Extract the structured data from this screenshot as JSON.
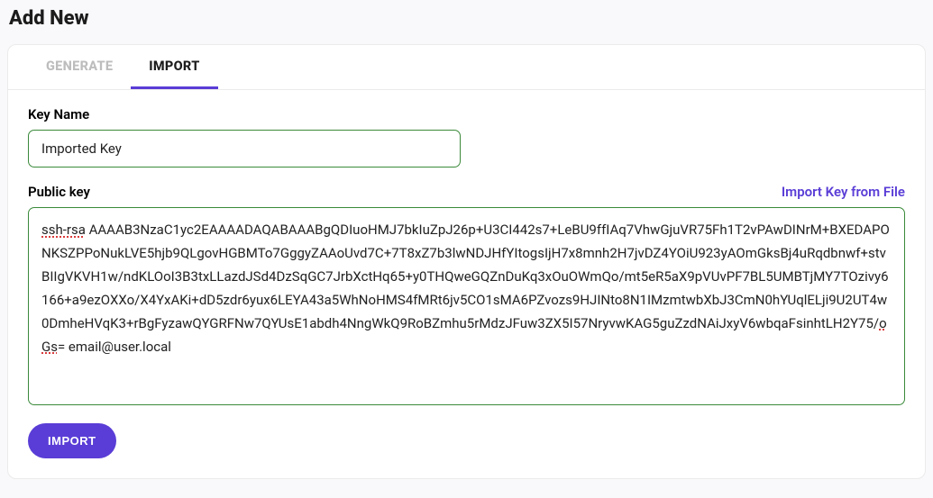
{
  "page_title": "Add New",
  "tabs": {
    "generate_label": "GENERATE",
    "import_label": "IMPORT"
  },
  "key_name": {
    "label": "Key Name",
    "value": "Imported Key"
  },
  "public_key": {
    "label": "Public key",
    "import_file_link": "Import Key from File",
    "value_prefix": "ssh-rsa",
    "value_body": " AAAAB3NzaC1yc2EAAAADAQABAAABgQDIuoHMJ7bkIuZpJ26p+U3CI442s7+LeBU9ffIAq7VhwGjuVR75Fh1T2vPAwDINrM+BXEDAPONKSZPPoNukLVE5hjb9QLgovHGBMTo7GggyZAAoUvd7C+7T8xZ7b3lwNDJHfYItogsIjH7x8mnh2H7jvDZ4YOiU923yAOmGksBj4uRqdbnwf+stvBIIgVKVH1w/ndKLOoI3B3txLLazdJSd4DzSqGC7JrbXctHq65+y0THQweGQZnDuKq3xOuOWmQo/mt5eR5aX9pVUvPF7BL5UMBTjMY7TOzivy6166+a9ezOXXo/X4YxAKi+dD5zdr6yux6LEYA43a5WhNoHMS4fMRt6jv5CO1sMA6PZvozs9HJINto8N1IMzmtwbXbJ3CmN0hYUqlELji9U2UT4w0DmheHVqK3+rBgFyzawQYGRFNw7QYUsE1abdh4NngWkQ9RoBZmhu5rMdzJFuw3ZX5I57NryvwKAG5guZzdNAiJxyV6wbqaFsinhtLH2Y75/",
    "value_underlined_tail": "oGs",
    "value_suffix": "= email@user.local"
  },
  "buttons": {
    "import_label": "IMPORT"
  }
}
